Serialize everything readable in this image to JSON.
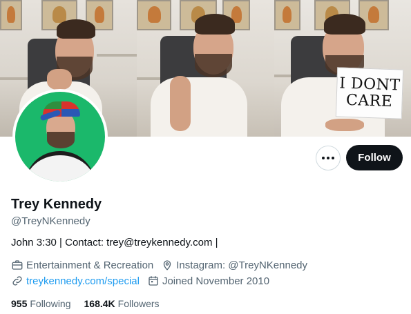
{
  "profile": {
    "name": "Trey Kennedy",
    "handle": "@TreyNKennedy",
    "bio": "John 3:30 | Contact: trey@treykennedy.com |",
    "category": "Entertainment & Recreation",
    "location": "Instagram: @TreyNKennedy",
    "website": "treykennedy.com/special",
    "joined": "Joined November 2010"
  },
  "banner": {
    "sign_line1": "I DONT",
    "sign_line2": "CARE"
  },
  "actions": {
    "follow_label": "Follow",
    "more_icon": "more-horizontal-icon"
  },
  "stats": {
    "following_count": "955",
    "following_label": "Following",
    "followers_count": "168.4K",
    "followers_label": "Followers"
  },
  "colors": {
    "accent_link": "#1d9bf0",
    "follow_bg": "#0f1419",
    "secondary_text": "#536471",
    "avatar_bg": "#1bb86b"
  },
  "icons": {
    "category": "briefcase-icon",
    "location": "location-pin-icon",
    "website": "link-icon",
    "joined": "calendar-icon"
  }
}
